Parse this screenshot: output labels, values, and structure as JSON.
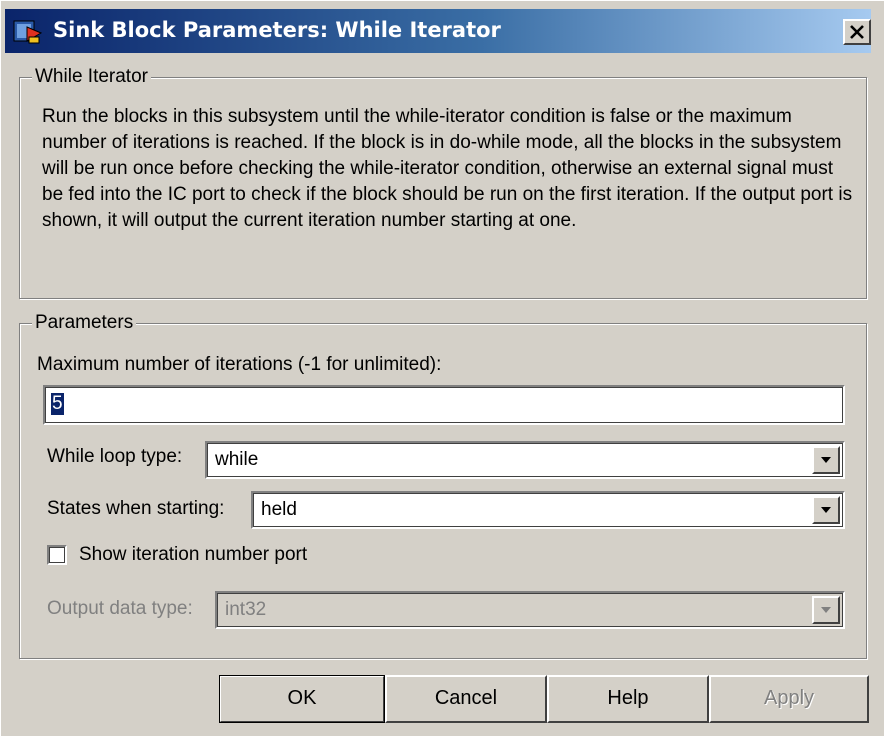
{
  "window": {
    "title": "Sink Block Parameters: While Iterator",
    "icon": "simulink-block-icon",
    "close_icon": "close-icon"
  },
  "description_group": {
    "legend": "While Iterator",
    "text": "Run the blocks in this subsystem until the while-iterator condition is false or the maximum number of iterations is reached.  If the block is in do-while mode, all the blocks in the subsystem will be run once before checking the while-iterator condition, otherwise an external signal must be fed into the IC port to check if the block should be run on the first iteration. If the output port is shown, it will output the current iteration number starting at one."
  },
  "parameters": {
    "legend": "Parameters",
    "max_iterations": {
      "label": "Maximum number of iterations (-1 for unlimited):",
      "value": "5"
    },
    "loop_type": {
      "label": "While loop type:",
      "value": "while"
    },
    "states_when_starting": {
      "label": "States when starting:",
      "value": "held"
    },
    "show_iteration_port": {
      "label": "Show iteration number port",
      "checked": false
    },
    "output_data_type": {
      "label": "Output data type:",
      "value": "int32",
      "enabled": false
    }
  },
  "buttons": {
    "ok": "OK",
    "cancel": "Cancel",
    "help": "Help",
    "apply": "Apply"
  },
  "colors": {
    "titlebar_start": "#0a246a",
    "titlebar_end": "#a6caf0",
    "face": "#d4d0c8",
    "selection": "#0a246a"
  }
}
